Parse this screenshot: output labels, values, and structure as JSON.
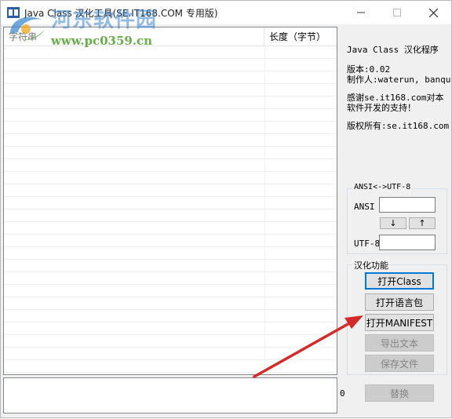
{
  "window": {
    "title": "Java Class 汉化工具(SE.IT168.COM 专用版)"
  },
  "watermark": {
    "site_name": "河东软件园",
    "url": "www.pc0359.cn"
  },
  "table": {
    "columns": [
      "字符串",
      "长度（字节）"
    ],
    "rows": []
  },
  "info": {
    "app_name": "Java Class 汉化程序",
    "version": "版本:0.02",
    "author": "制作人:waterun, banqu",
    "thanks_line1": "感谢se.it168.com对本",
    "thanks_line2": "软件开发的支持！",
    "copyright": "版权所有:se.it168.com"
  },
  "converter": {
    "legend": "ANSI<->UTF-8",
    "ansi_label": "ANSI",
    "utf8_label": "UTF-8",
    "ansi_value": "",
    "utf8_value": "",
    "down_arrow": "↓",
    "up_arrow": "↑"
  },
  "functions": {
    "legend": "汉化功能",
    "open_class": "打开Class",
    "open_lang_pack": "打开语言包",
    "open_manifest": "打开MANIFEST",
    "export_text": "导出文本",
    "save_file": "保存文件"
  },
  "bottom": {
    "count": "0",
    "replace": "替换"
  },
  "colors": {
    "accent": "#0078d7",
    "annotation_arrow": "#d42a2a"
  }
}
